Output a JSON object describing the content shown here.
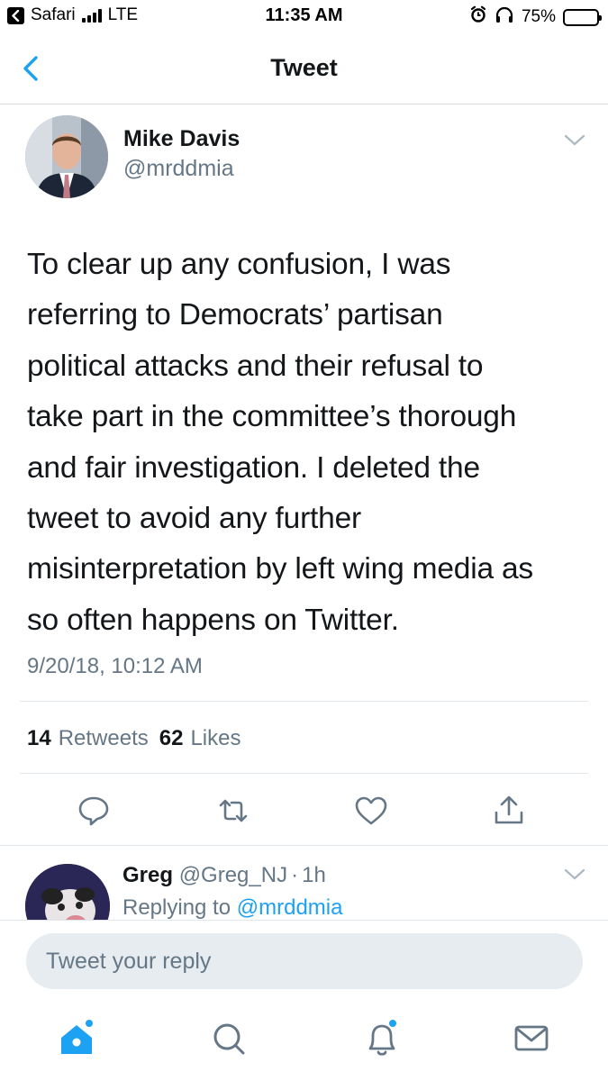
{
  "status_bar": {
    "back_app": "Safari",
    "network": "LTE",
    "time": "11:35 AM",
    "battery": "75%",
    "battery_level": 0.75,
    "icons": [
      "back-arrow-icon",
      "signal-icon",
      "alarm-icon",
      "headphones-icon",
      "battery-icon"
    ]
  },
  "nav": {
    "title": "Tweet",
    "back_icon": "chevron-left-icon"
  },
  "tweet": {
    "author_name": "Mike Davis",
    "author_handle": "@mrddmia",
    "text_lines": [
      "To clear up any confusion, I was",
      "referring to Democrats’ partisan",
      "political attacks and their refusal to",
      "take part in the committee’s thorough",
      "and fair investigation. I deleted the",
      "tweet to avoid any further",
      "misinterpretation by left wing media as",
      "so often happens on Twitter."
    ],
    "timestamp": "9/20/18, 10:12 AM",
    "retweets_count": "14",
    "retweets_label": "Retweets",
    "likes_count": "62",
    "likes_label": "Likes",
    "actions": [
      "reply-icon",
      "retweet-icon",
      "like-icon",
      "share-icon"
    ]
  },
  "reply": {
    "name": "Greg",
    "handle": "@Greg_NJ",
    "separator": "·",
    "age": "1h",
    "replying_prefix": "Replying to",
    "replying_to": "@mrddmia"
  },
  "composer": {
    "placeholder": "Tweet your reply"
  },
  "tab_bar": {
    "tabs": [
      "home-icon",
      "search-icon",
      "notifications-icon",
      "messages-icon"
    ],
    "active": "home-icon"
  },
  "colors": {
    "accent": "#1da1f2",
    "text_primary": "#14171a",
    "text_secondary": "#657786",
    "divider": "#e1e8ed",
    "composer_bg": "#e6ecf0"
  }
}
